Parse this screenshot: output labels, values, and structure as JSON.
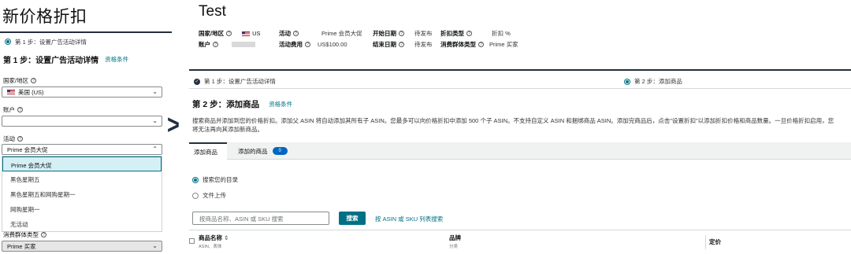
{
  "left": {
    "title": "新价格折扣",
    "step_label": "第 1 步：设置广告活动详情",
    "heading": "第 1 步：设置广告活动详情",
    "eligibility_link": "资格条件",
    "country_label": "国家/地区",
    "country_value": "美国 (US)",
    "account_label": "账户",
    "account_value": "",
    "event_label": "活动",
    "event_value": "Prime 会员大促",
    "event_options": [
      "Prime 会员大促",
      "黑色星期五",
      "黑色星期五和网购星期一",
      "网购星期一",
      "无活动"
    ],
    "consumer_label": "消费群体类型",
    "consumer_value": "Prime 买家"
  },
  "arrow": ">",
  "right": {
    "title": "Test",
    "meta": {
      "country_label": "国家/地区",
      "country_value": "US",
      "account_label": "账户",
      "event_label": "活动",
      "event_value": "Prime 会员大促",
      "event_fee_label": "活动费用",
      "event_fee_value": "US$100.00",
      "start_label": "开始日期",
      "start_value": "待发布",
      "end_label": "结束日期",
      "end_value": "待发布",
      "discount_type_label": "折扣类型",
      "discount_type_value": "折扣 %",
      "consumer_label": "消费群体类型",
      "consumer_value": "Prime 买家"
    },
    "step1": "第 1 步：设置广告活动详情",
    "step2": "第 2 步：添加商品",
    "heading": "第 2 步：添加商品",
    "eligibility_link": "资格条件",
    "description": "搜索商品并添加到您的价格折扣。添加父 ASIN 将自动添加其所有子 ASIN。您最多可以向价格折扣中添加 500 个子 ASIN。不支持自定义 ASIN 和捆绑商品 ASIN。添加完商品后，点击\"设置折扣\"以添加折扣价格和商品数量。一旦价格折扣启用，您将无法再向其添加新商品。",
    "tab_add": "添加商品",
    "tab_added": "添加的商品",
    "added_count": "0",
    "radio_catalog": "搜索您的目录",
    "radio_upload": "文件上传",
    "search_placeholder": "按商品名称、ASIN 或 SKU 搜索",
    "search_button": "搜索",
    "bulk_link": "按 ASIN 或 SKU 列表搜索",
    "col_name": "商品名称",
    "col_name_sub": "ASIN、表体",
    "col_brand": "品牌",
    "col_brand_sub": "分类",
    "col_price": "定价"
  }
}
